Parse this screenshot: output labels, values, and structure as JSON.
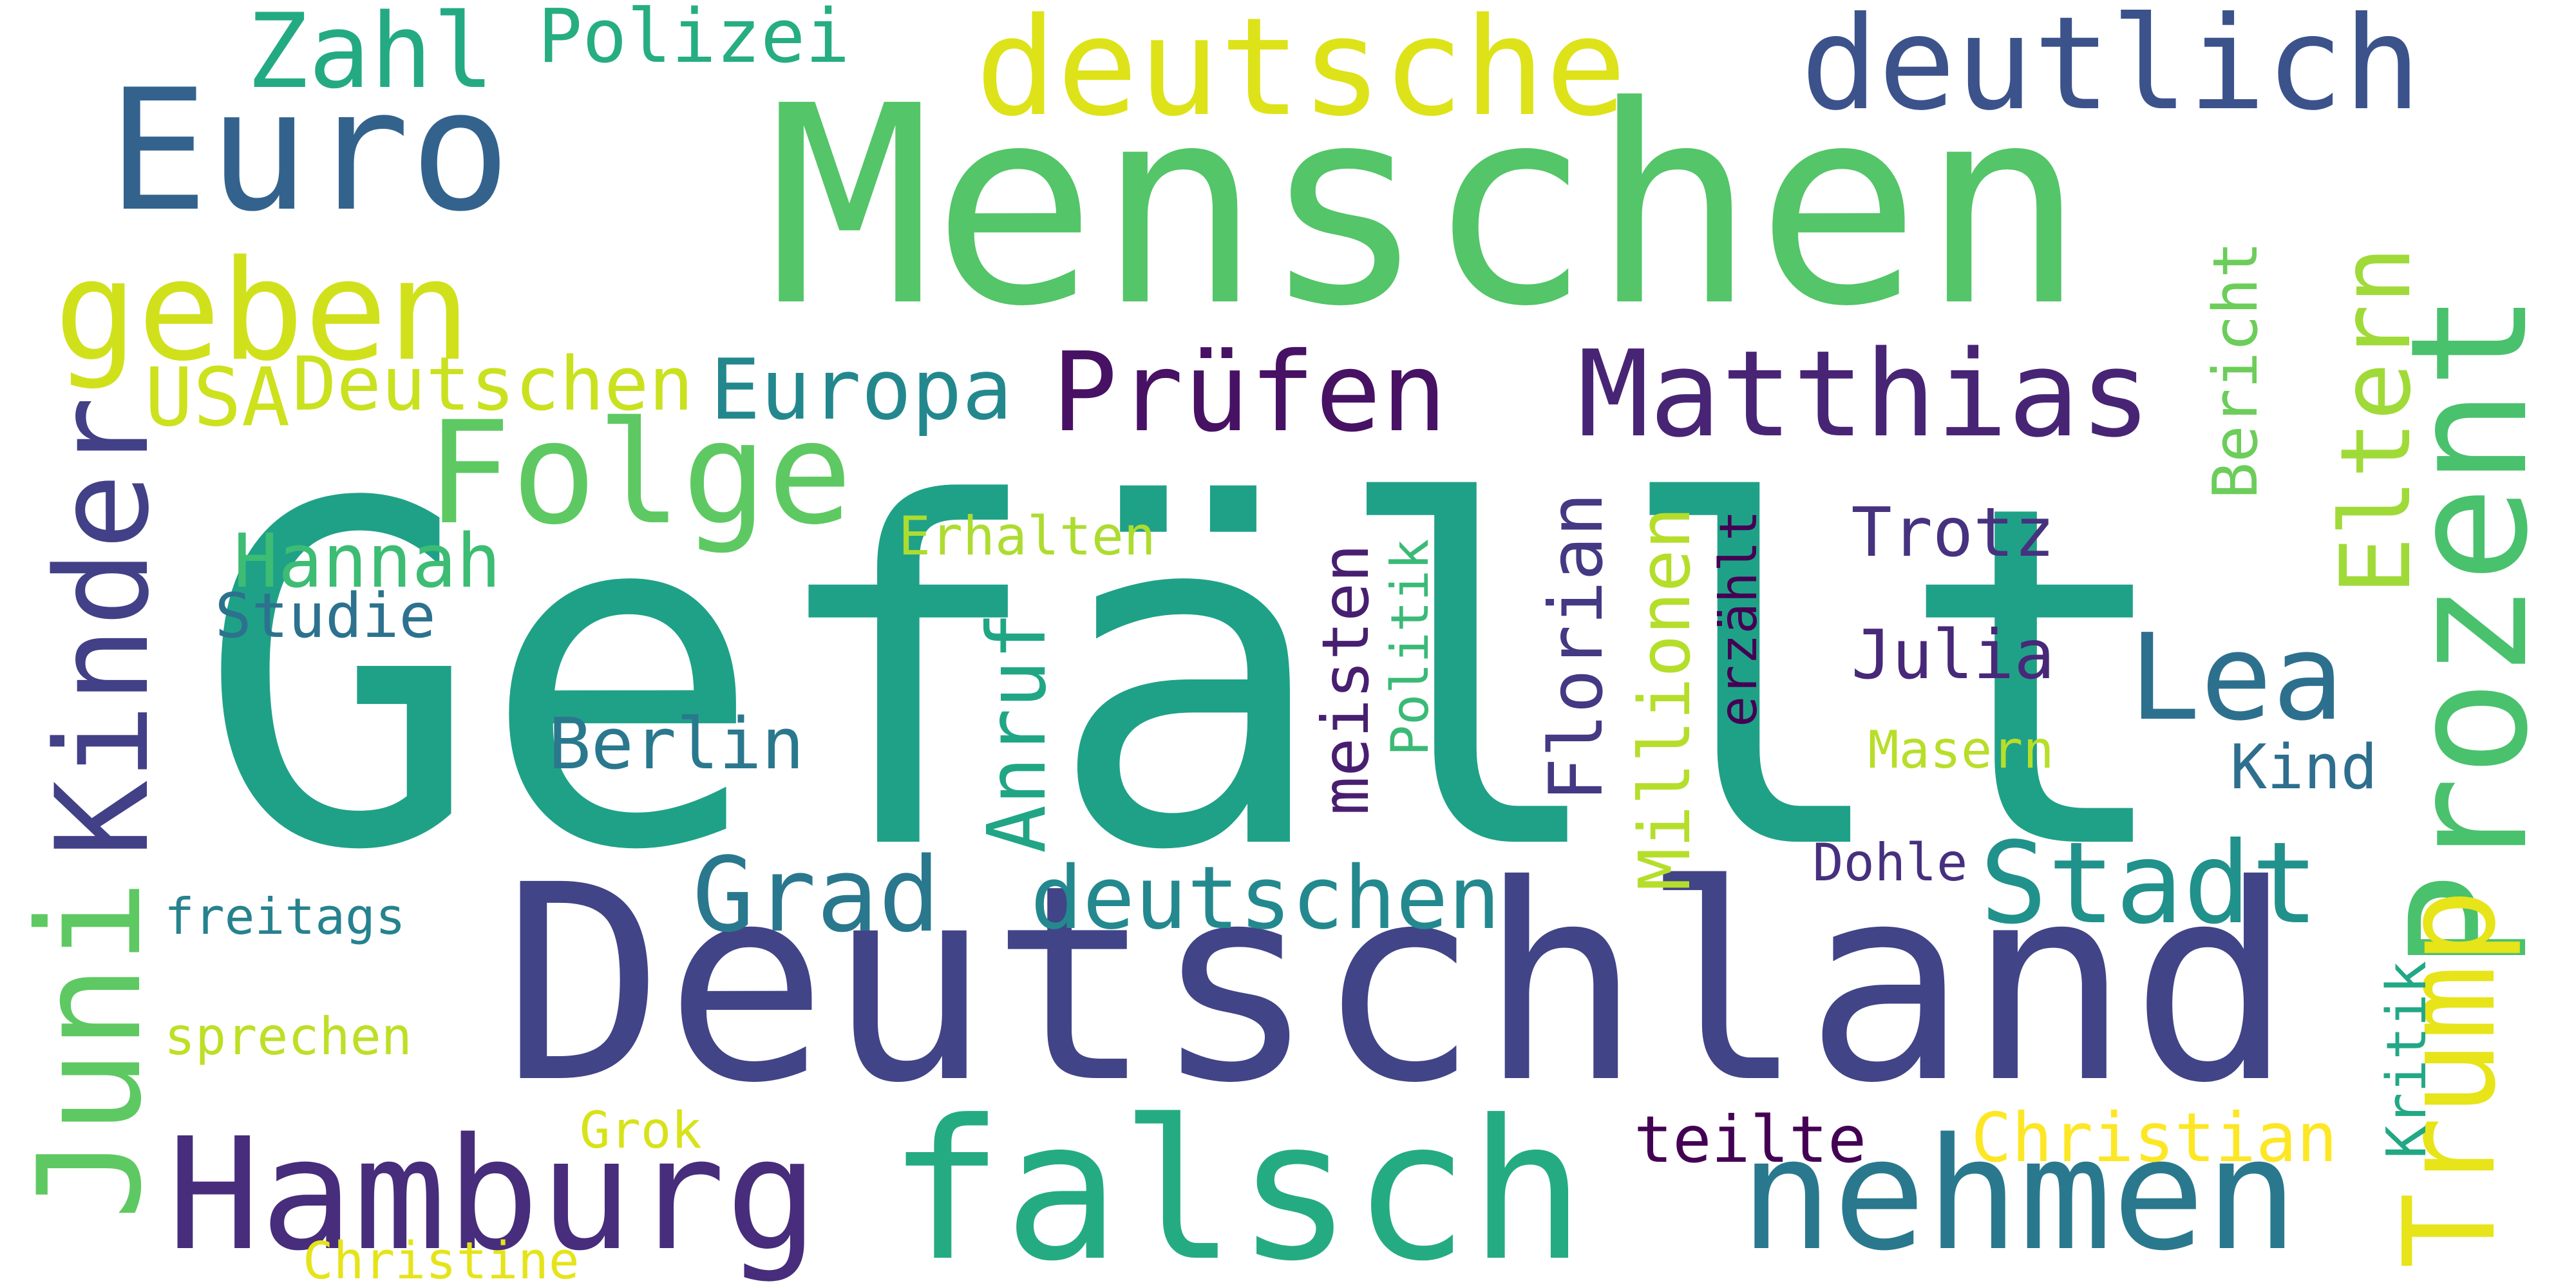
{
  "word_cloud": {
    "background": "#ffffff",
    "words": [
      {
        "text": "Gefällt",
        "color": "#1fa187",
        "vertical": false
      },
      {
        "text": "Menschen",
        "color": "#54c568",
        "vertical": false
      },
      {
        "text": "Deutschland",
        "color": "#414487",
        "vertical": false
      },
      {
        "text": "falsch",
        "color": "#25ab82",
        "vertical": false
      },
      {
        "text": "nehmen",
        "color": "#2a788e",
        "vertical": false
      },
      {
        "text": "Hamburg",
        "color": "#472d7b",
        "vertical": false
      },
      {
        "text": "Euro",
        "color": "#33638d",
        "vertical": false
      },
      {
        "text": "deutsche",
        "color": "#dde318",
        "vertical": false
      },
      {
        "text": "deutlich",
        "color": "#3b528b",
        "vertical": false
      },
      {
        "text": "Prozent",
        "color": "#4ac16d",
        "vertical": true
      },
      {
        "text": "geben",
        "color": "#d0e11c",
        "vertical": false
      },
      {
        "text": "Folge",
        "color": "#5ec962",
        "vertical": false
      },
      {
        "text": "Prüfen",
        "color": "#471164",
        "vertical": false
      },
      {
        "text": "Matthias",
        "color": "#482475",
        "vertical": false
      },
      {
        "text": "Juni",
        "color": "#5ec962",
        "vertical": true
      },
      {
        "text": "Kinder",
        "color": "#424086",
        "vertical": true
      },
      {
        "text": "Trump",
        "color": "#e7e419",
        "vertical": true
      },
      {
        "text": "Elter­n",
        "color": "#a0da39",
        "vertical": true
      },
      {
        "text": "Lea",
        "color": "#2d708e",
        "vertical": false
      },
      {
        "text": "Stadt",
        "color": "#21918c",
        "vertical": false
      },
      {
        "text": "Grad",
        "color": "#2a788e",
        "vertical": false
      },
      {
        "text": "deutschen",
        "color": "#23898e",
        "vertical": false
      },
      {
        "text": "Zahl",
        "color": "#24aa83",
        "vertical": false
      },
      {
        "text": "Polizei",
        "color": "#26ad81",
        "vertical": false
      },
      {
        "text": "Europa",
        "color": "#23888e",
        "vertical": false
      },
      {
        "text": "USA",
        "color": "#cde11d",
        "vertical": false
      },
      {
        "text": "Deutschen",
        "color": "#cae11f",
        "vertical": false
      },
      {
        "text": "Hannah",
        "color": "#3dbc74",
        "vertical": false
      },
      {
        "text": "Studie",
        "color": "#2c728e",
        "vertical": false
      },
      {
        "text": "Berlin",
        "color": "#2a788e",
        "vertical": false
      },
      {
        "text": "Erhalten",
        "color": "#addc30",
        "vertical": false
      },
      {
        "text": "Anruf",
        "color": "#21a685",
        "vertical": true
      },
      {
        "text": "meisten",
        "color": "#481f70",
        "vertical": true
      },
      {
        "text": "Politik",
        "color": "#3aba76",
        "vertical": true
      },
      {
        "text": "Florian",
        "color": "#443983",
        "vertical": true
      },
      {
        "text": "Millionen",
        "color": "#b5de2b",
        "vertical": true
      },
      {
        "text": "erzählt",
        "color": "#440154",
        "vertical": true
      },
      {
        "text": "Trotz",
        "color": "#46327e",
        "vertical": false
      },
      {
        "text": "Julia",
        "color": "#482878",
        "vertical": false
      },
      {
        "text": "Bericht",
        "color": "#6ccd5a",
        "vertical": true
      },
      {
        "text": "Kind",
        "color": "#2e6e8e",
        "vertical": false
      },
      {
        "text": "Masern",
        "color": "#b8de29",
        "vertical": false
      },
      {
        "text": "Dohle",
        "color": "#46307e",
        "vertical": false
      },
      {
        "text": "freitags",
        "color": "#26828e",
        "vertical": false
      },
      {
        "text": "sprechen",
        "color": "#bddf26",
        "vertical": false
      },
      {
        "text": "Kritik",
        "color": "#22a884",
        "vertical": true
      },
      {
        "text": "Christian",
        "color": "#fde725",
        "vertical": false
      },
      {
        "text": "teilte",
        "color": "#440154",
        "vertical": false
      },
      {
        "text": "Grok",
        "color": "#d8e219",
        "vertical": false
      },
      {
        "text": "Christine",
        "color": "#e5e419",
        "vertical": false
      }
    ]
  }
}
